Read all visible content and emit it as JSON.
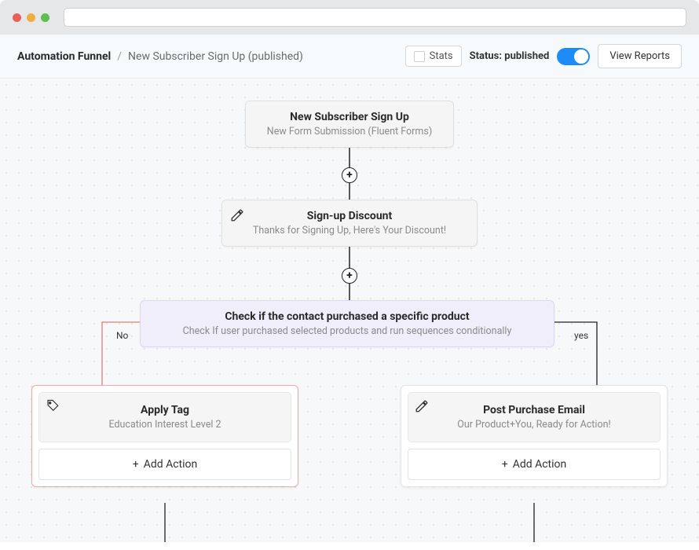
{
  "breadcrumb": {
    "root": "Automation Funnel",
    "sep": "/",
    "current": "New Subscriber Sign Up (published)"
  },
  "header": {
    "stats": "Stats",
    "status_prefix": "Status:",
    "status_value": "published",
    "view_reports": "View Reports"
  },
  "trigger": {
    "title": "New Subscriber Sign Up",
    "sub": "New Form Submission (Fluent Forms)"
  },
  "email": {
    "title": "Sign-up Discount",
    "sub": "Thanks for Signing Up, Here's Your Discount!"
  },
  "cond": {
    "title": "Check if the contact purchased a specific product",
    "sub": "Check If user purchased selected products and run sequences conditionally"
  },
  "branches": {
    "no": "No",
    "yes": "yes"
  },
  "left_block": {
    "title": "Apply Tag",
    "sub": "Education Interest Level 2",
    "add": "Add Action"
  },
  "right_block": {
    "title": "Post Purchase Email",
    "sub": "Our Product+You, Ready for Action!",
    "add": "Add Action"
  },
  "plus": "+"
}
